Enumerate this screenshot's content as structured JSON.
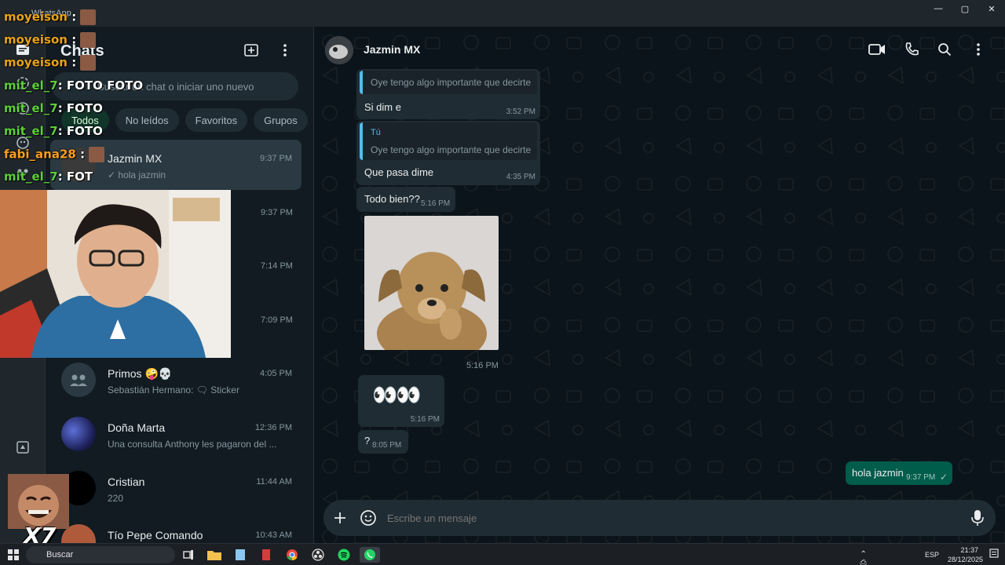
{
  "window": {
    "title": "WhatsApp",
    "controls": [
      "—",
      "▢",
      "✕"
    ]
  },
  "sidebar": {
    "title": "Chats",
    "search_placeholder": "Buscar un chat o iniciar uno nuevo",
    "filters": [
      "Todos",
      "No leídos",
      "Favoritos",
      "Grupos"
    ],
    "chats": [
      {
        "name": "Jazmin MX",
        "time": "9:37 PM",
        "preview": "✓ hola jazmin",
        "active": true
      },
      {
        "name": "",
        "time": "9:37 PM",
        "preview": ""
      },
      {
        "name": "",
        "time": "7:14 PM",
        "preview": ""
      },
      {
        "name": "",
        "time": "7:09 PM",
        "preview": ""
      },
      {
        "name": "Primos 🤪💀",
        "time": "4:05 PM",
        "preview": "Sebastián Hermano: 🗨 Sticker"
      },
      {
        "name": "Doña Marta",
        "time": "12:36 PM",
        "preview": "Una consulta Anthony les pagaron del ..."
      },
      {
        "name": "Cristian",
        "time": "11:44 AM",
        "preview": "220"
      },
      {
        "name": "Tío Pepe Comando",
        "time": "10:43 AM",
        "preview": ""
      }
    ]
  },
  "conversation": {
    "contact": "Jazmin MX",
    "messages": [
      {
        "quote_text": "Oye tengo algo importante que decirte",
        "text": "Si dim e",
        "time": "3:52 PM"
      },
      {
        "quote_author": "Tú",
        "quote_text": "Oye tengo algo importante que decirte",
        "text": "Que pasa dime",
        "time": "4:35 PM"
      },
      {
        "text": "Todo bien??",
        "time": "5:16 PM"
      },
      {
        "type": "sticker",
        "time": "5:16 PM"
      },
      {
        "text": "👀👀",
        "time": "5:16 PM"
      },
      {
        "text": "?",
        "time": "8:05 PM"
      },
      {
        "text": "hola jazmin",
        "time": "9:37 PM",
        "status": "✓",
        "outgoing": true
      }
    ],
    "composer_placeholder": "Escribe un mensaje"
  },
  "overlay": {
    "chat_lines": [
      {
        "user": "moyeison",
        "text": ":"
      },
      {
        "user": "moyeison",
        "text": ":"
      },
      {
        "user": "moyeison",
        "text": ":"
      },
      {
        "user": "mit_el_7",
        "text": ": FOTO FOTO"
      },
      {
        "user": "mit_el_7",
        "text": ": FOTO"
      },
      {
        "user": "mit_el_7",
        "text": ": FOTO"
      },
      {
        "user": "fabi_ana28",
        "text": ":"
      },
      {
        "user": "mit_el_7",
        "text": ": FOT"
      }
    ],
    "emote_caption": "X7"
  },
  "taskbar": {
    "search_label": "Buscar",
    "language": "ESP",
    "time": "21:37",
    "date": "28/12/2025"
  }
}
